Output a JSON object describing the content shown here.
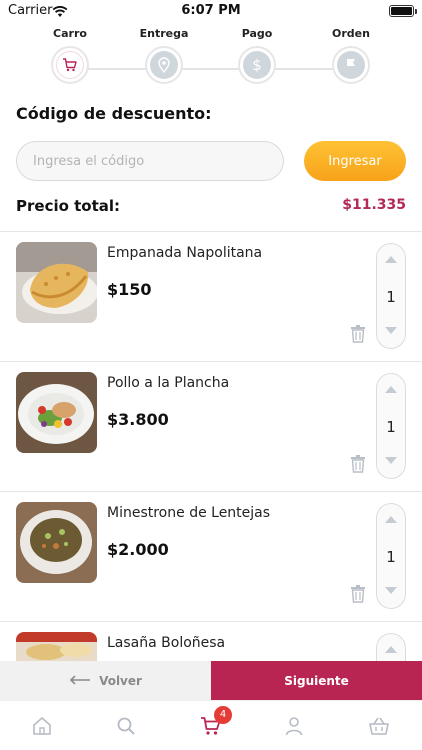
{
  "status_bar": {
    "carrier": "Carrier",
    "time": "6:07 PM"
  },
  "stepper": {
    "steps": [
      {
        "label": "Carro",
        "icon": "cart-icon",
        "active": true
      },
      {
        "label": "Entrega",
        "icon": "location-icon",
        "active": false
      },
      {
        "label": "Pago",
        "icon": "dollar-icon",
        "active": false
      },
      {
        "label": "Orden",
        "icon": "flag-icon",
        "active": false
      }
    ]
  },
  "discount": {
    "title": "Código de descuento:",
    "placeholder": "Ingresa el código",
    "value": "",
    "apply_label": "Ingresar"
  },
  "total": {
    "label": "Precio total:",
    "value": "$11.335"
  },
  "cart": {
    "items": [
      {
        "name": "Empanada Napolitana",
        "price": "$150",
        "quantity": "1"
      },
      {
        "name": "Pollo a la Plancha",
        "price": "$3.800",
        "quantity": "1"
      },
      {
        "name": "Minestrone de Lentejas",
        "price": "$2.000",
        "quantity": "1"
      },
      {
        "name": "Lasaña Boloñesa",
        "price": "",
        "quantity": ""
      }
    ]
  },
  "footer": {
    "back_label": "Volver",
    "next_label": "Siguiente"
  },
  "tab_bar": {
    "cart_badge": "4"
  },
  "colors": {
    "accent": "#b82553",
    "price_accent": "#b22a58",
    "button_orange": "#f9ad22",
    "badge_red": "#e53c37"
  }
}
